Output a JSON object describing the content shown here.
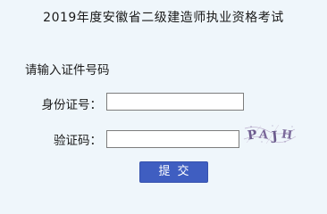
{
  "header": {
    "title": "2019年度安徽省二级建造师执业资格考试"
  },
  "form": {
    "prompt": "请输入证件号码",
    "id_label": "身份证号：",
    "id_value": "",
    "code_label": "验证码：",
    "code_value": "",
    "captcha_text": "PAJH",
    "submit_label": "提交"
  }
}
